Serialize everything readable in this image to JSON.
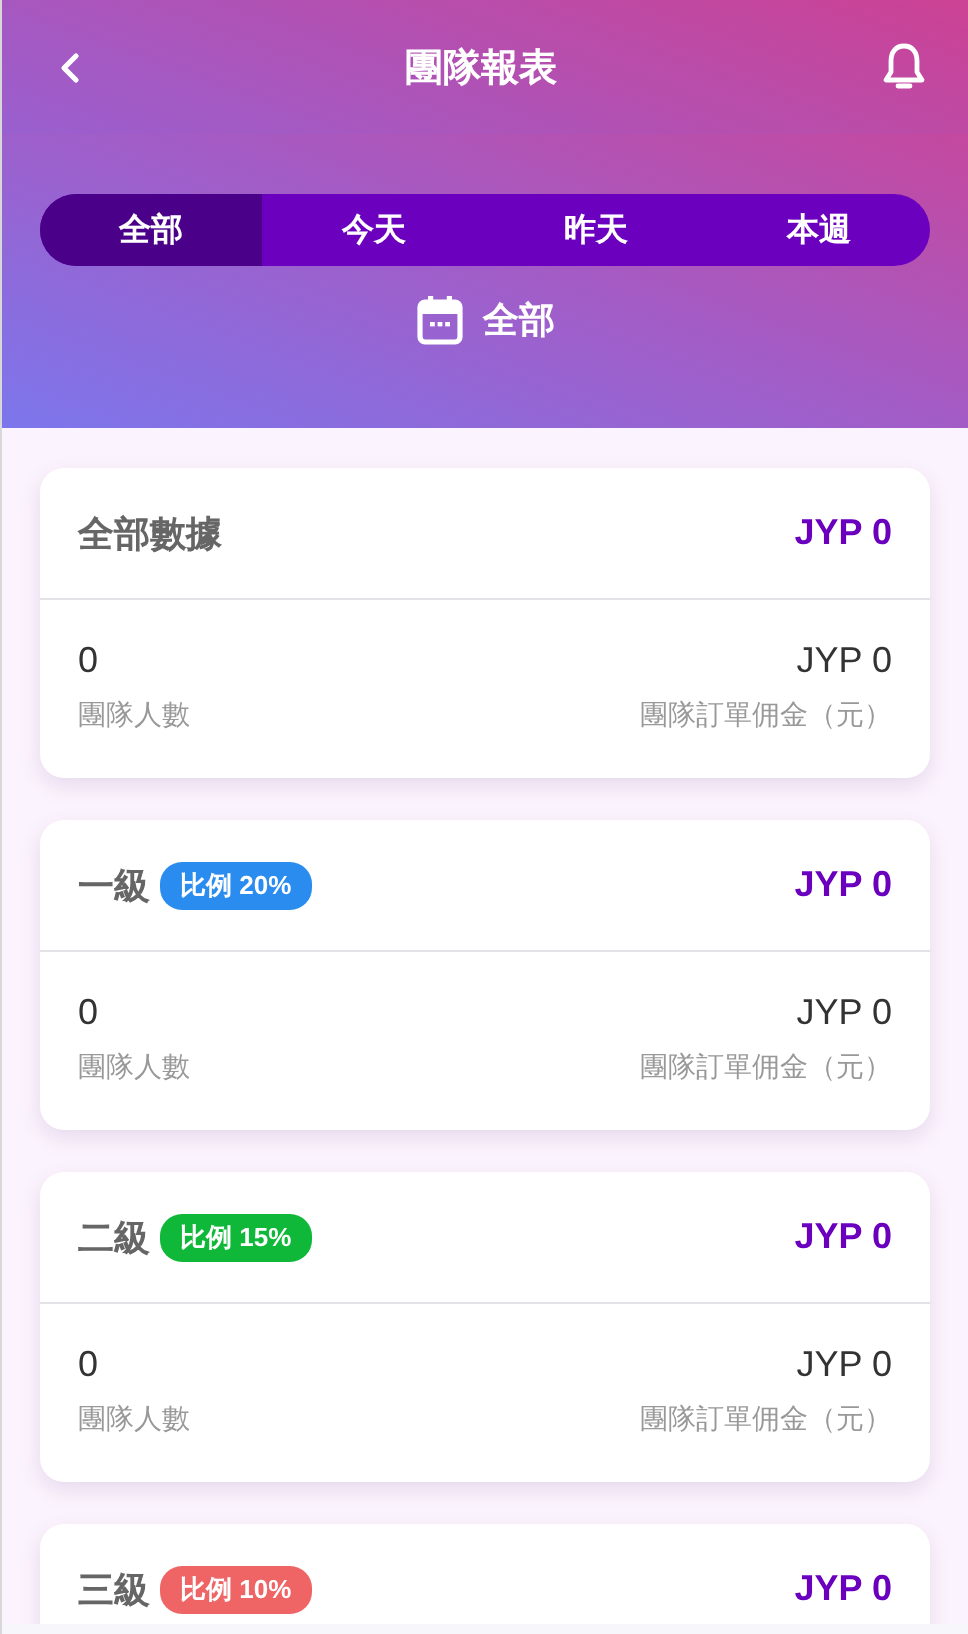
{
  "header": {
    "title": "團隊報表"
  },
  "tabs": [
    {
      "label": "全部",
      "selected": true
    },
    {
      "label": "今天",
      "selected": false
    },
    {
      "label": "昨天",
      "selected": false
    },
    {
      "label": "本週",
      "selected": false
    }
  ],
  "date_range": "全部",
  "cards": [
    {
      "title": "全部數據",
      "amount": "JYP 0",
      "members": "0",
      "members_label": "團隊人數",
      "commission": "JYP 0",
      "commission_label": "團隊訂單佣金（元）"
    },
    {
      "title": "一級",
      "badge": {
        "label": "比例 20%",
        "color": "#2b8cf0"
      },
      "amount": "JYP 0",
      "members": "0",
      "members_label": "團隊人數",
      "commission": "JYP 0",
      "commission_label": "團隊訂單佣金（元）"
    },
    {
      "title": "二級",
      "badge": {
        "label": "比例 15%",
        "color": "#10b83a"
      },
      "amount": "JYP 0",
      "members": "0",
      "members_label": "團隊人數",
      "commission": "JYP 0",
      "commission_label": "團隊訂單佣金（元）"
    },
    {
      "title": "三級",
      "badge": {
        "label": "比例 10%",
        "color": "#ef6464"
      },
      "amount": "JYP 0"
    }
  ]
}
